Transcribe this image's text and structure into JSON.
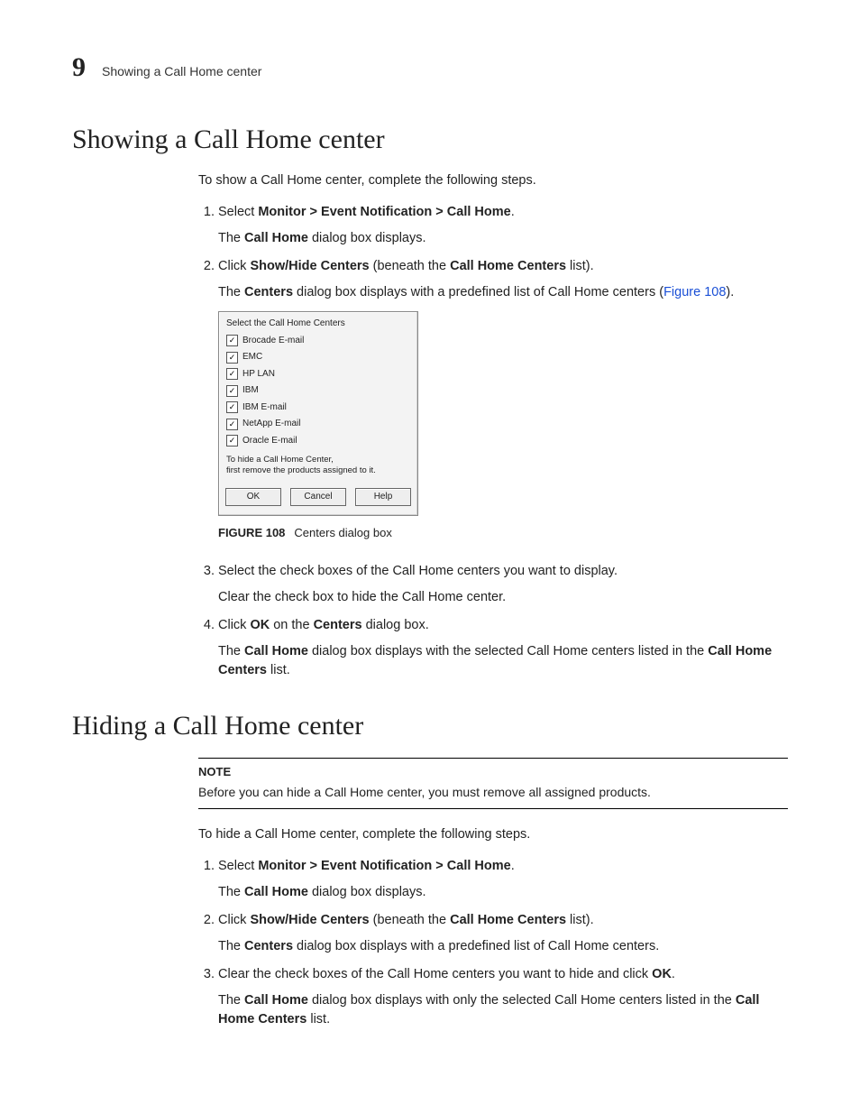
{
  "header": {
    "chapter_number": "9",
    "running_title": "Showing a Call Home center"
  },
  "section1": {
    "title": "Showing a Call Home center",
    "intro": "To show a Call Home center, complete the following steps.",
    "step1": {
      "prefix": "Select ",
      "bold": "Monitor > Event Notification > Call Home",
      "suffix": ".",
      "sub_a": "The ",
      "sub_b": "Call Home",
      "sub_c": " dialog box displays."
    },
    "step2": {
      "a": "Click ",
      "b": "Show/Hide Centers",
      "c": " (beneath the ",
      "d": "Call Home Centers",
      "e": " list).",
      "sub_a": "The ",
      "sub_b": "Centers",
      "sub_c": " dialog box displays with a predefined list of Call Home centers (",
      "xref": "Figure 108",
      "sub_d": ")."
    },
    "step3": {
      "text": "Select the check boxes of the Call Home centers you want to display.",
      "sub": "Clear the check box to hide the Call Home center."
    },
    "step4": {
      "a": "Click ",
      "b": "OK",
      "c": " on the ",
      "d": "Centers",
      "e": " dialog box.",
      "sub_a": "The ",
      "sub_b": "Call Home",
      "sub_c": " dialog box displays with the selected Call Home centers listed in the ",
      "sub_d": "Call Home Centers",
      "sub_e": " list."
    }
  },
  "figure": {
    "num": "FIGURE 108",
    "caption": "Centers dialog box"
  },
  "dialog": {
    "title": "Select the Call Home Centers",
    "items": [
      "Brocade E-mail",
      "EMC",
      "HP LAN",
      "IBM",
      "IBM E-mail",
      "NetApp E-mail",
      "Oracle E-mail"
    ],
    "hint1": "To hide a Call Home Center,",
    "hint2": "first remove the products assigned to it.",
    "buttons": {
      "ok": "OK",
      "cancel": "Cancel",
      "help": "Help"
    }
  },
  "section2": {
    "title": "Hiding a Call Home center",
    "note_label": "NOTE",
    "note_text": "Before you can hide a Call Home center, you must remove all assigned products.",
    "intro": "To hide a Call Home center, complete the following steps.",
    "step1": {
      "prefix": "Select ",
      "bold": "Monitor > Event Notification > Call Home",
      "suffix": ".",
      "sub_a": "The ",
      "sub_b": "Call Home",
      "sub_c": " dialog box displays."
    },
    "step2": {
      "a": "Click ",
      "b": "Show/Hide Centers",
      "c": " (beneath the ",
      "d": "Call Home Centers",
      "e": " list).",
      "sub_a": "The ",
      "sub_b": "Centers",
      "sub_c": " dialog box displays with a predefined list of Call Home centers."
    },
    "step3": {
      "a": "Clear the check boxes of the Call Home centers you want to hide and click ",
      "b": "OK",
      "c": ".",
      "sub_a": "The ",
      "sub_b": "Call Home",
      "sub_c": " dialog box displays with only the selected Call Home centers listed in the ",
      "sub_d": "Call Home Centers",
      "sub_e": " list."
    }
  }
}
